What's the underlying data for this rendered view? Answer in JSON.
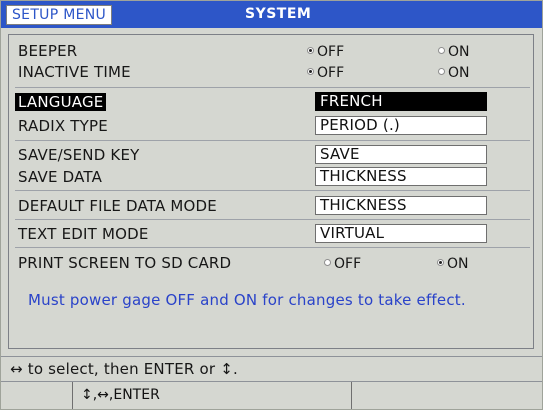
{
  "header": {
    "menu_tab": "SETUP MENU",
    "title": "SYSTEM",
    "bar_color": "#2d56c8"
  },
  "settings": {
    "beeper": {
      "label": "BEEPER",
      "opt1": "OFF",
      "opt2": "ON",
      "selected": "OFF"
    },
    "inactive_time": {
      "label": "INACTIVE TIME",
      "opt1": "OFF",
      "opt2": "ON",
      "selected": "OFF"
    },
    "language": {
      "label": "LANGUAGE",
      "value": "FRENCH"
    },
    "radix_type": {
      "label": "RADIX TYPE",
      "value": "PERIOD (.)"
    },
    "save_send_key": {
      "label": "SAVE/SEND KEY",
      "value": "SAVE"
    },
    "save_data": {
      "label": "SAVE DATA",
      "value": "THICKNESS"
    },
    "default_file_data_mode": {
      "label": "DEFAULT FILE DATA MODE",
      "value": "THICKNESS"
    },
    "text_edit_mode": {
      "label": "TEXT EDIT MODE",
      "value": "VIRTUAL"
    },
    "print_screen": {
      "label": "PRINT SCREEN TO SD CARD",
      "opt1": "OFF",
      "opt2": "ON",
      "selected": "ON"
    }
  },
  "note": "Must power gage OFF and ON for changes to take effect.",
  "status": {
    "hint": "↔ to select, then ENTER or ↕.",
    "keys": "↕,↔,ENTER"
  },
  "selected_row": "LANGUAGE"
}
